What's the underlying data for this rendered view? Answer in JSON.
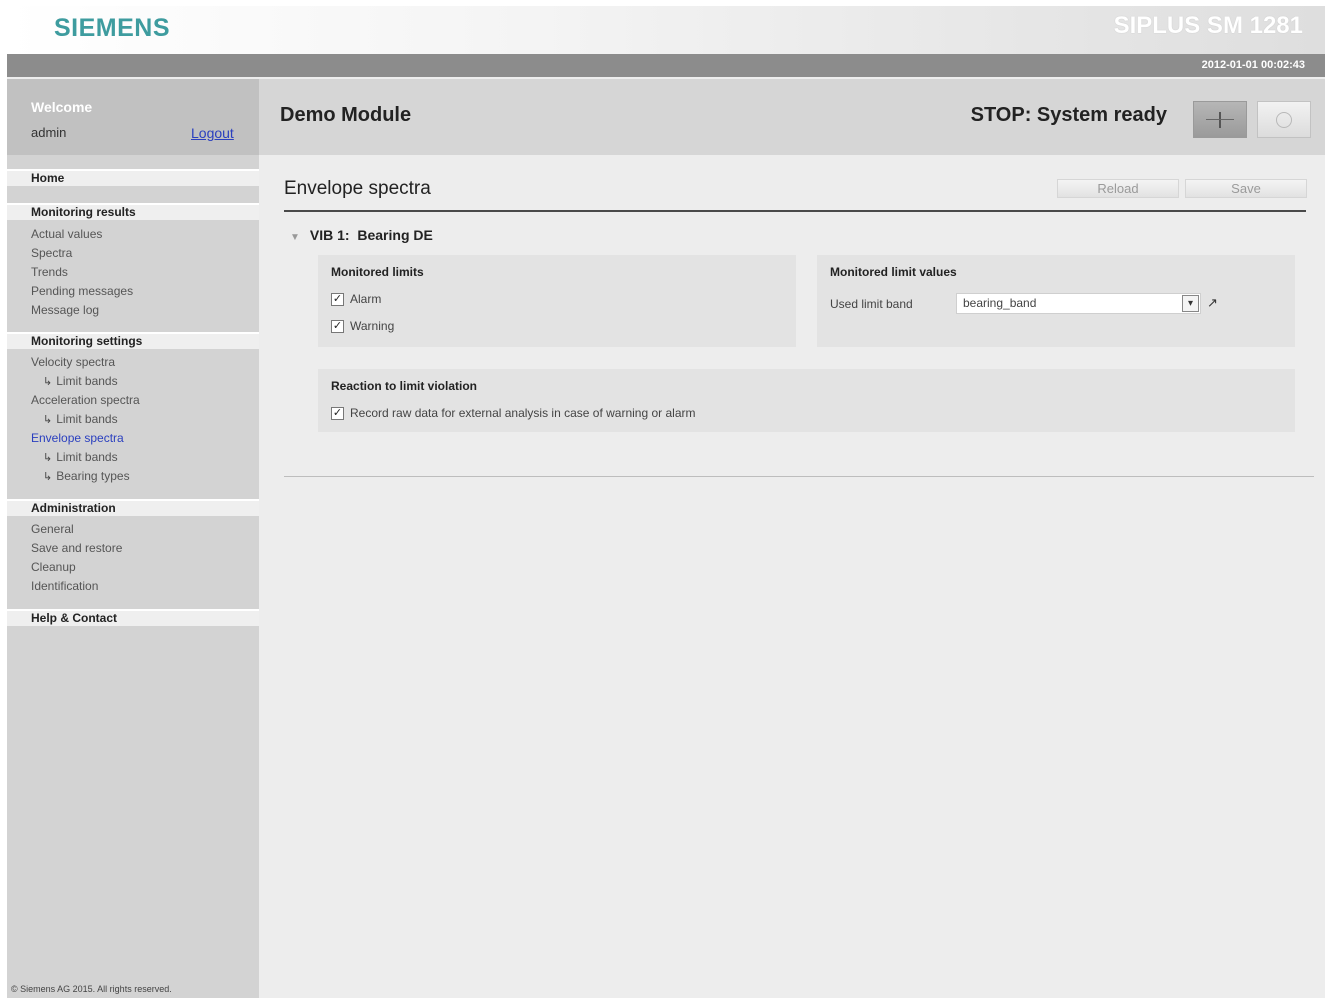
{
  "header": {
    "brand": "SIEMENS",
    "product": "SIPLUS SM 1281",
    "datetime": "2012-01-01 00:02:43"
  },
  "sidebar": {
    "welcome_title": "Welcome",
    "user": "admin",
    "logout_label": "Logout",
    "home": "Home",
    "monitoring_results": {
      "heading": "Monitoring results",
      "items": [
        "Actual values",
        "Spectra",
        "Trends",
        "Pending messages",
        "Message log"
      ]
    },
    "monitoring_settings": {
      "heading": "Monitoring settings",
      "items": [
        {
          "label": "Velocity spectra"
        },
        {
          "label": "Limit bands"
        },
        {
          "label": "Acceleration spectra"
        },
        {
          "label": "Limit bands"
        },
        {
          "label": "Envelope spectra"
        },
        {
          "label": "Limit bands"
        },
        {
          "label": "Bearing types"
        }
      ]
    },
    "administration": {
      "heading": "Administration",
      "items": [
        "General",
        "Save and restore",
        "Cleanup",
        "Identification"
      ]
    },
    "help": "Help & Contact",
    "footer": "© Siemens AG 2015. All rights reserved."
  },
  "main": {
    "module_name": "Demo Module",
    "status": "STOP: System ready",
    "section_title": "Envelope spectra",
    "reload_label": "Reload",
    "save_label": "Save",
    "vib_prefix": "VIB 1:",
    "vib_name": "Bearing DE",
    "monitored_limits": {
      "title": "Monitored limits",
      "alarm_label": "Alarm",
      "alarm_checked": true,
      "warning_label": "Warning",
      "warning_checked": true
    },
    "monitored_limit_values": {
      "title": "Monitored limit values",
      "field_label": "Used limit band",
      "selected": "bearing_band"
    },
    "reaction": {
      "title": "Reaction to limit violation",
      "record_label": "Record raw data for external analysis in case of warning or alarm",
      "record_checked": true
    }
  },
  "colors": {
    "brand": "#3e9c9f",
    "active_link": "#2a3fbf"
  }
}
